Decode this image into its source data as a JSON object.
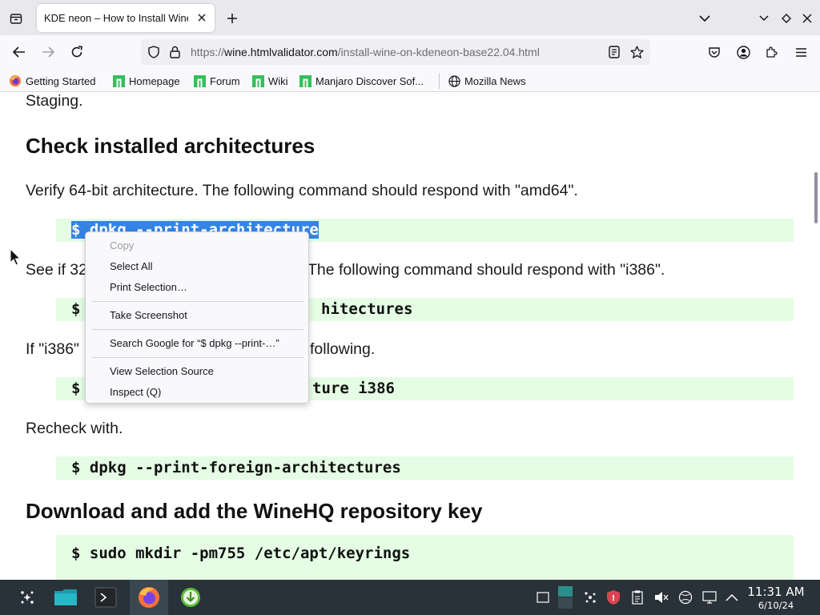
{
  "browser": {
    "tab": {
      "title": "KDE neon – How to Install Wine on KDE neon"
    },
    "url": {
      "scheme": "https://",
      "host": "wine.htmlvalidator.com",
      "path": "/install-wine-on-kdeneon-base22.04.html"
    },
    "bookmarks": [
      {
        "label": "Getting Started",
        "icon": "firefox-icon"
      },
      {
        "label": "Homepage",
        "icon": "manjaro-icon"
      },
      {
        "label": "Forum",
        "icon": "manjaro-icon"
      },
      {
        "label": "Wiki",
        "icon": "manjaro-icon"
      },
      {
        "label": "Manjaro Discover Sof...",
        "icon": "manjaro-icon"
      },
      {
        "label": "Mozilla News",
        "icon": "globe-icon"
      }
    ]
  },
  "page": {
    "intro_tail": "Staging.",
    "heading_architectures": "Check installed architectures",
    "verify_text": "Verify 64-bit architecture. The following command should respond with \"amd64\".",
    "cmd_print_arch": "$ dpkg --print-architecture",
    "see_if_text_start": "See if 32",
    "see_if_text_end": "The following command should respond with \"i386\".",
    "cmd_foreign_partial": "hitectures",
    "cmd_prompt": "$",
    "if_text_start": "If \"i386\"",
    "if_text_end": "following.",
    "cmd_add_arch_partial": "ture i386",
    "recheck_text": "Recheck with.",
    "cmd_print_foreign": "$ dpkg --print-foreign-architectures",
    "heading_download": "Download and add the WineHQ repository key",
    "cmd_mkdir": "$ sudo mkdir -pm755 /etc/apt/keyrings"
  },
  "context_menu": {
    "items": [
      {
        "label": "Copy",
        "enabled": false
      },
      {
        "label": "Select All",
        "enabled": true
      },
      {
        "label": "Print Selection…",
        "enabled": true
      },
      {
        "label": "Take Screenshot",
        "enabled": true
      },
      {
        "label": "Search Google for “$ dpkg --print-…”",
        "enabled": true
      },
      {
        "label": "View Selection Source",
        "enabled": true
      },
      {
        "label": "Inspect (Q)",
        "enabled": true
      }
    ]
  },
  "taskbar": {
    "clock": {
      "time": "11:31 AM",
      "date": "6/10/24"
    },
    "tray_alert_badge": "!"
  },
  "colors": {
    "code_background": "#e4fde4",
    "selection": "#3584e4",
    "taskbar": "#283238"
  }
}
